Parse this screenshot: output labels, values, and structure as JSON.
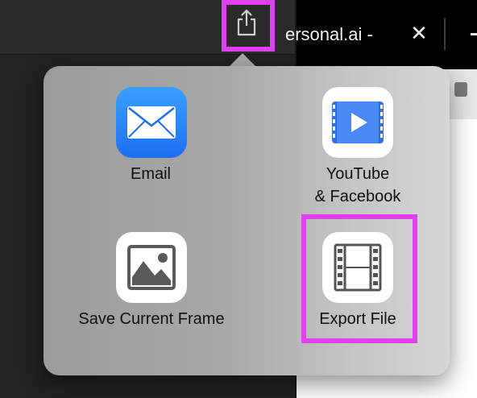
{
  "browser": {
    "tab_title": "ersonal.ai -",
    "close_glyph": "✕"
  },
  "share_menu": {
    "items": [
      {
        "label": "Email",
        "icon": "mail-envelope-icon"
      },
      {
        "label": "YouTube\n& Facebook",
        "label_line1": "YouTube",
        "label_line2": "& Facebook",
        "icon": "video-play-icon"
      },
      {
        "label": "Save Current Frame",
        "icon": "photo-frame-icon"
      },
      {
        "label": "Export File",
        "icon": "film-strip-icon"
      }
    ]
  },
  "colors": {
    "highlight": "#e040f0",
    "mail_blue": "#1d6ff0",
    "video_blue": "#2f6fe0"
  }
}
